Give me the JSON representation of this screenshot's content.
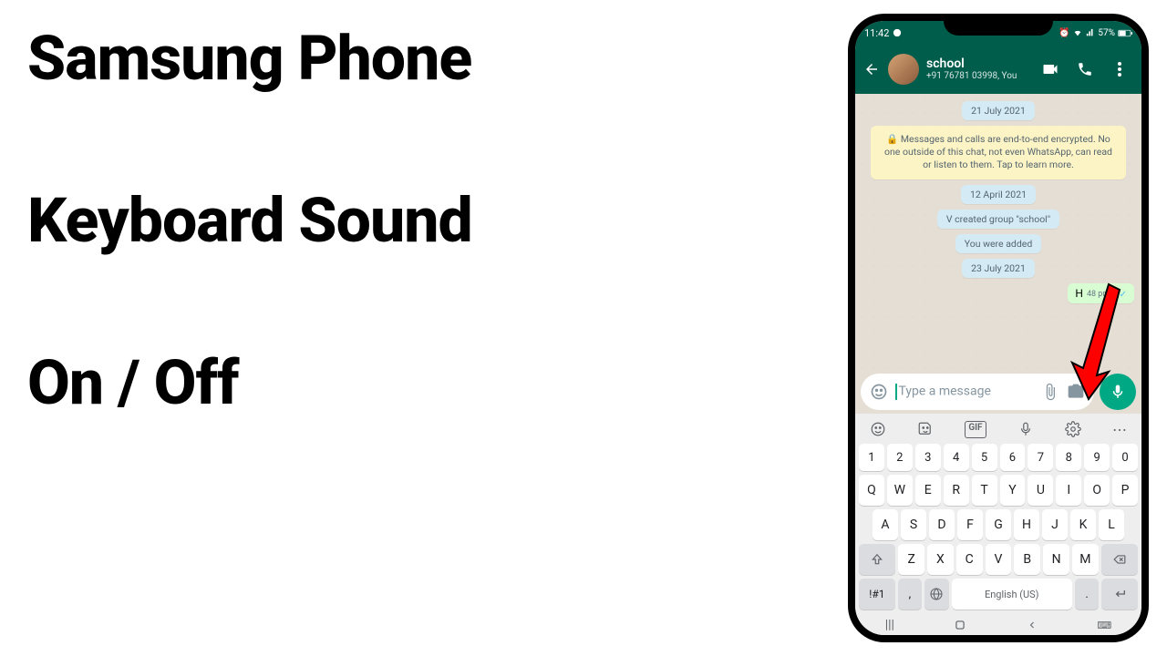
{
  "title": {
    "line1": "Samsung Phone",
    "line2": "Keyboard Sound",
    "line3": "On / Off"
  },
  "statusbar": {
    "time": "11:42",
    "battery": "57%"
  },
  "chat": {
    "name": "school",
    "subtitle": "+91 76781 03998, You",
    "date1": "21 July 2021",
    "e2e": "🔒 Messages and calls are end-to-end encrypted. No one outside of this chat, not even WhatsApp, can read or listen to them. Tap to learn more.",
    "date2": "12 April 2021",
    "sys1": "V created group \"school\"",
    "sys2": "You were added",
    "date3": "23 July 2021",
    "msg_text": "H",
    "msg_time": "48 pm",
    "placeholder": "Type a message"
  },
  "kb": {
    "nums": [
      "1",
      "2",
      "3",
      "4",
      "5",
      "6",
      "7",
      "8",
      "9",
      "0"
    ],
    "row1": [
      "Q",
      "W",
      "E",
      "R",
      "T",
      "Y",
      "U",
      "I",
      "O",
      "P"
    ],
    "row2": [
      "A",
      "S",
      "D",
      "F",
      "G",
      "H",
      "J",
      "K",
      "L"
    ],
    "row3": [
      "Z",
      "X",
      "C",
      "V",
      "B",
      "N",
      "M"
    ],
    "sym": "!#1",
    "lang": "English (US)",
    "period": "."
  }
}
